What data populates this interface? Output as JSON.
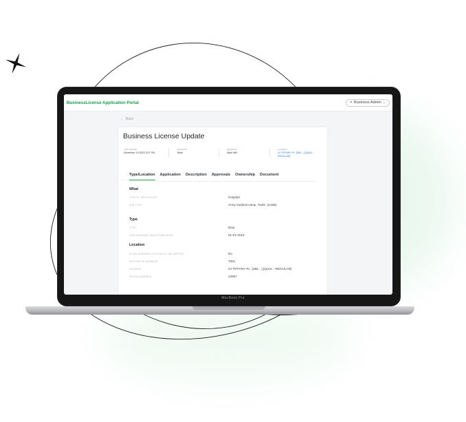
{
  "app": {
    "brand": "BusinessLicense Application Portal",
    "user_menu": "Business Admin"
  },
  "page": {
    "back": "Back",
    "title": "Business License Update"
  },
  "meta": [
    {
      "key": "Last Update",
      "value": "December 19 2023 3:27 PM"
    },
    {
      "key": "Business",
      "value": "Wisk"
    },
    {
      "key": "Applicant",
      "value": "Mark Will"
    },
    {
      "key": "Location",
      "value": "24 TIFFANY PL. [SBL - ] [QUAL - REGULAR]"
    }
  ],
  "tabs": [
    "Type/Location",
    "Application",
    "Description",
    "Approvals",
    "Ownership",
    "Document"
  ],
  "sections": {
    "what": {
      "title": "What",
      "rows": [
        {
          "label": "Type of Application",
          "value": "Hospital"
        },
        {
          "label": "Sub Type",
          "value": "Army medical camp. Tooth. (Unit5)"
        }
      ]
    },
    "type": {
      "title": "Type",
      "rows": [
        {
          "label": "Type",
          "value": "New"
        },
        {
          "label": "Date Business Was Established",
          "value": "01-01-2016"
        }
      ]
    },
    "location": {
      "title": "Location",
      "rows": [
        {
          "label": "Is the business located at the airport",
          "value": "No"
        },
        {
          "label": "Zipcode of Business",
          "value": "7001"
        },
        {
          "label": "Address",
          "value": "24 TIFFANY PL. [SBL - ] [QUAL - REGULAR]"
        },
        {
          "label": "Postal Address",
          "value": "12867"
        }
      ]
    }
  },
  "device": {
    "label": "MacBook Pro"
  },
  "colors": {
    "brand": "#17a34a",
    "link": "#2f76d9",
    "tab_underline": "#16a34a"
  }
}
